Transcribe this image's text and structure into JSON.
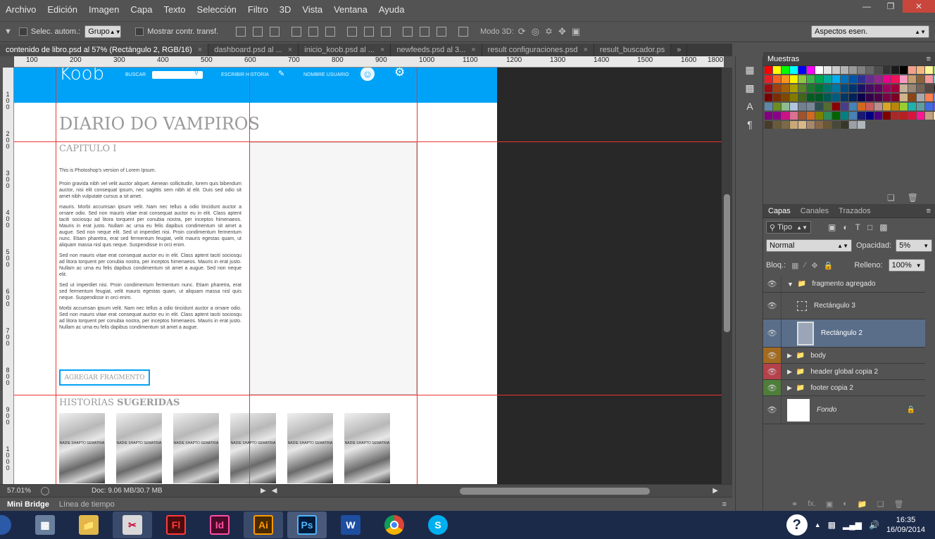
{
  "menu": [
    "Archivo",
    "Edición",
    "Imagen",
    "Capa",
    "Texto",
    "Selección",
    "Filtro",
    "3D",
    "Vista",
    "Ventana",
    "Ayuda"
  ],
  "options": {
    "auto_select_label": "Selec. autom.:",
    "auto_select_value": "Grupo",
    "show_transform_label": "Mostrar contr. transf.",
    "mode3d_label": "Modo 3D:",
    "workspace": "Aspectos esen."
  },
  "tabs": [
    {
      "label": "contenido de libro.psd al 57% (Rectángulo 2, RGB/16)",
      "active": true
    },
    {
      "label": "dashboard.psd al ...",
      "active": false
    },
    {
      "label": "inicio_koob.psd al ...",
      "active": false
    },
    {
      "label": "newfeeds.psd al 3...",
      "active": false
    },
    {
      "label": "result configuraciones.psd",
      "active": false
    },
    {
      "label": "result_buscador.ps",
      "active": false
    }
  ],
  "ruler_top": [
    "100",
    "200",
    "300",
    "400",
    "500",
    "600",
    "700",
    "800",
    "900",
    "1000",
    "1100",
    "1200",
    "1300",
    "1400",
    "1500",
    "1600",
    "1700",
    "1800"
  ],
  "ruler_left": [
    "100",
    "200",
    "300",
    "400",
    "500",
    "600",
    "700",
    "800",
    "900",
    "1000"
  ],
  "doc": {
    "logo": "Koob",
    "search_label": "BUSCAR",
    "write_label": "ESCRIBIR HISTORIA",
    "user_label": "NOMBRE USUARIO",
    "book_title": "DIARIO DO VAMPIROS",
    "chapter": "CAPITULO I",
    "p0": "This is Photoshop's version  of Lorem Ipsum.",
    "p1": "Proin gravida nibh vel velit auctor aliquet. Aenean sollicitudin, lorem quis bibendum auctor, nisi elit consequat ipsum, nec sagittis sem nibh id elit. Duis sed odio sit amet nibh vulputate cursus a sit amet.",
    "p2": "mauris. Morbi accumsan ipsum velit. Nam nec tellus a odio tincidunt auctor a ornare odio. Sed non  mauris vitae erat consequat auctor eu in elit. Class aptent taciti sociosqu ad litora torquent per conubia nostra, per inceptos himenaeos. Mauris in erat justo. Nullam ac urna eu felis dapibus condimentum sit amet a augue. Sed non neque elit. Sed ut imperdiet nisi. Proin condimentum fermentum nunc. Etiam pharetra, erat sed fermentum feugiat, velit mauris egestas quam, ut aliquam massa nisl quis neque. Suspendisse in orci enim.",
    "p3": "Sed non  mauris vitae erat consequat auctor eu in elit. Class aptent taciti sociosqu ad litora torquent per conubia nostra, per inceptos himenaeos. Mauris in erat justo. Nullam ac urna eu felis dapibus condimentum sit amet a augue. Sed non neque elit.",
    "p4": "Sed ut imperdiet nisi. Proin condimentum fermentum nunc. Etiam pharetra, erat sed fermentum feugiat, velit mauris egestas quam, ut aliquam massa nisl quis neque. Suspendisse in orci enim.",
    "p5": "Morbi accumsan ipsum velit. Nam nec tellus a odio tincidunt auctor a ornare odio. Sed non  mauris vitae erat consequat auctor eu in elit. Class aptent taciti sociosqu ad litora torquent per conubia nostra, per inceptos himenaeos. Mauris in erat justo. Nullam ac urna eu felis dapibus condimentum sit amet a augue.",
    "add_fragment": "AGREGAR FRAGMENTO",
    "suggested_a": "HISTORIAS ",
    "suggested_b": "SUGERIDAS",
    "thumb_text": "NADIE SHAPTO SEMATRIA"
  },
  "status": {
    "zoom": "57.01%",
    "doc": "Doc: 9.06 MB/30.7 MB"
  },
  "bottom_tabs": [
    "Mini Bridge",
    "Línea de tiempo"
  ],
  "panels": {
    "swatches_title": "Muestras",
    "layers_tabs": [
      "Capas",
      "Canales",
      "Trazados"
    ],
    "kind": "Tipo",
    "blend": "Normal",
    "opacity_label": "Opacidad:",
    "opacity": "5%",
    "lock_label": "Bloq.:",
    "fill_label": "Relleno:",
    "fill": "100%"
  },
  "layers": [
    {
      "name": "fragmento agregado",
      "type": "group-open",
      "color": ""
    },
    {
      "name": "Rectángulo 3",
      "type": "shape",
      "color": ""
    },
    {
      "name": "Rectángulo 2",
      "type": "shape-selected",
      "color": ""
    },
    {
      "name": "body",
      "type": "group",
      "color": "#a36b1f"
    },
    {
      "name": "header global copia 2",
      "type": "group",
      "color": "#b5424a"
    },
    {
      "name": "footer copia 2",
      "type": "group",
      "color": "#4f7d3a"
    },
    {
      "name": "Fondo",
      "type": "background",
      "color": ""
    }
  ],
  "clock": {
    "time": "16:35",
    "date": "16/09/2014"
  },
  "colors": {
    "accent": "#00a2f7",
    "guide": "#ee3333"
  }
}
